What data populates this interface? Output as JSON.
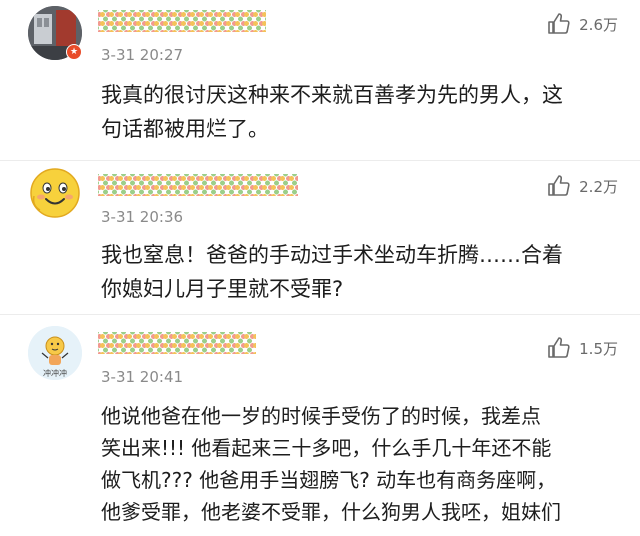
{
  "comments": [
    {
      "timestamp": "3-31 20:27",
      "likes": "2.6万",
      "text": "我真的很讨厌这种来不来就百善孝为先的男人，这\n句话都被用烂了。"
    },
    {
      "timestamp": "3-31 20:36",
      "likes": "2.2万",
      "text": "我也窒息！爸爸的手动过手术坐动车折腾……合着\n你媳妇儿月子里就不受罪?"
    },
    {
      "timestamp": "3-31 20:41",
      "likes": "1.5万",
      "avatar_caption": "冲冲冲",
      "text": "他说他爸在他一岁的时候手受伤了的时候，我差点\n笑出来!!! 他看起来三十多吧，什么手几十年还不能\n做飞机??? 他爸用手当翅膀飞? 动车也有商务座啊，\n他爹受罪，他老婆不受罪，什么狗男人我呸，姐妹们"
    }
  ],
  "icons": {
    "like": "thumbs-up-icon",
    "badge": "star-badge-icon"
  },
  "colors": {
    "timestamp": "#8a8a8a",
    "text": "#1d1d1d",
    "like": "#6a6a6a"
  }
}
